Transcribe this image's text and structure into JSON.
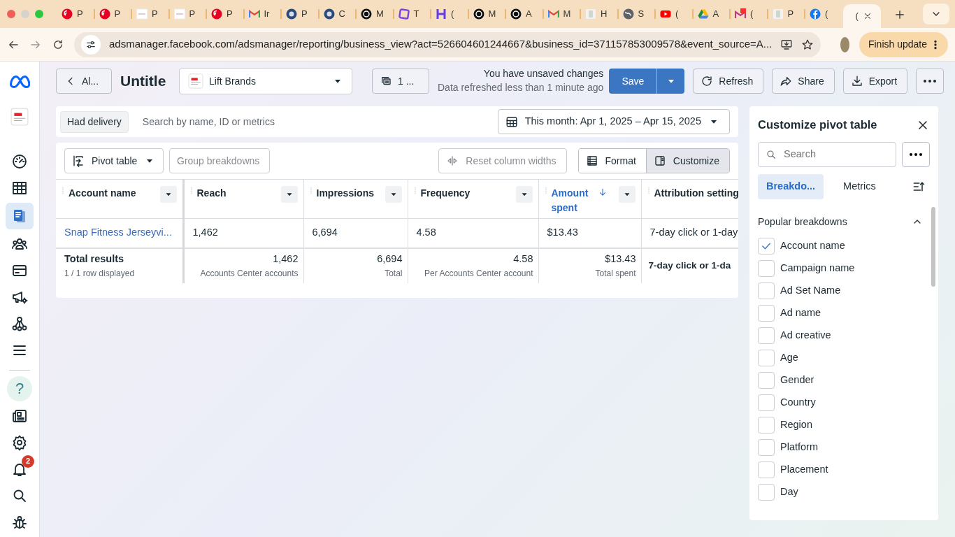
{
  "browser": {
    "tabs": [
      {
        "kind": "pin",
        "label": "P",
        "selected": false
      },
      {
        "kind": "pin",
        "label": "P",
        "selected": false
      },
      {
        "kind": "thumb",
        "label": "P",
        "selected": false
      },
      {
        "kind": "thumb",
        "label": "P",
        "selected": false
      },
      {
        "kind": "pin",
        "label": "P",
        "selected": false
      },
      {
        "kind": "mail",
        "label": "Ir",
        "selected": false
      },
      {
        "kind": "rider",
        "label": "P",
        "selected": false
      },
      {
        "kind": "rider",
        "label": "C",
        "selected": false
      },
      {
        "kind": "knot",
        "label": "M",
        "selected": false
      },
      {
        "kind": "square",
        "label": "T",
        "selected": false
      },
      {
        "kind": "hbar",
        "label": "(",
        "selected": false
      },
      {
        "kind": "knot",
        "label": "M",
        "selected": false
      },
      {
        "kind": "knot",
        "label": "A",
        "selected": false
      },
      {
        "kind": "mail",
        "label": "M",
        "selected": false
      },
      {
        "kind": "jar",
        "label": "H",
        "selected": false
      },
      {
        "kind": "globe",
        "label": "S",
        "selected": false
      },
      {
        "kind": "play",
        "label": "(",
        "selected": false
      },
      {
        "kind": "drive",
        "label": "A",
        "selected": false
      },
      {
        "kind": "mailbadge",
        "label": "(",
        "selected": false
      },
      {
        "kind": "jar",
        "label": "P",
        "selected": false
      },
      {
        "kind": "fb",
        "label": "(",
        "selected": false
      },
      {
        "kind": "blank",
        "label": "(",
        "selected": true
      }
    ],
    "url": "adsmanager.facebook.com/adsmanager/reporting/business_view?act=526604601244667&business_id=371157853009578&event_source=A...",
    "update_button": "Finish update"
  },
  "nav": {
    "items": [
      {
        "kind": "gauge",
        "selected": false
      },
      {
        "kind": "table",
        "selected": false
      },
      {
        "kind": "reports",
        "selected": true
      },
      {
        "kind": "people",
        "selected": false
      },
      {
        "kind": "card",
        "selected": false
      },
      {
        "kind": "megaphone",
        "selected": false
      },
      {
        "kind": "network",
        "selected": false
      },
      {
        "kind": "menu",
        "selected": false
      }
    ],
    "bottom_items": [
      {
        "kind": "help",
        "label": "?",
        "selected": false
      },
      {
        "kind": "news",
        "selected": false
      },
      {
        "kind": "gear",
        "selected": false
      },
      {
        "kind": "bell",
        "badge": "2",
        "selected": false
      },
      {
        "kind": "search",
        "selected": false
      },
      {
        "kind": "bug",
        "selected": false
      }
    ]
  },
  "header": {
    "back_button": "Al...",
    "title": "Untitle",
    "account": "Lift Brands",
    "views_button": "1 ...",
    "unsaved": "You have unsaved changes",
    "refreshed": "Data refreshed less than 1 minute ago",
    "buttons": [
      {
        "kind": "save",
        "label": "Save"
      },
      {
        "kind": "refresh",
        "label": "Refresh"
      },
      {
        "kind": "share",
        "label": "Share"
      },
      {
        "kind": "export",
        "label": "Export"
      },
      {
        "kind": "more"
      }
    ]
  },
  "filters": {
    "chip": "Had delivery",
    "search_placeholder": "Search by name, ID or metrics",
    "date": "This month: Apr 1, 2025 – Apr 15, 2025"
  },
  "toolbar": {
    "buttons": [
      {
        "kind": "pivot",
        "label": "Pivot table",
        "disabled": false
      },
      {
        "kind": "plain",
        "label": "Group breakdowns",
        "disabled": true
      },
      {
        "kind": "reset",
        "label": "Reset column widths",
        "disabled": true
      }
    ],
    "modes": [
      {
        "kind": "format",
        "label": "Format",
        "selected": false
      },
      {
        "kind": "customize",
        "label": "Customize",
        "selected": true
      }
    ]
  },
  "table": {
    "columns": [
      {
        "label": "Account name",
        "sorted": false
      },
      {
        "label": "Reach",
        "sorted": false
      },
      {
        "label": "Impressions",
        "sorted": false
      },
      {
        "label": "Frequency",
        "sorted": false
      },
      {
        "label": "Amount spent",
        "sorted": true
      },
      {
        "label": "Attribution setting",
        "sorted": false
      }
    ],
    "rows": [
      [
        "Snap Fitness Jerseyvi...",
        "1,462",
        "6,694",
        "4.58",
        "$13.43",
        "7-day click or 1-day"
      ]
    ],
    "totals": [
      {
        "value": "Total results",
        "note": "1 / 1 row displayed"
      },
      {
        "value": "1,462",
        "note": "Accounts Center accounts"
      },
      {
        "value": "6,694",
        "note": "Total"
      },
      {
        "value": "4.58",
        "note": "Per Accounts Center account"
      },
      {
        "value": "$13.43",
        "note": "Total spent"
      },
      {
        "value": "7-day click or 1-da"
      }
    ]
  },
  "panel": {
    "title": "Customize pivot table",
    "search_placeholder": "Search",
    "tabs": [
      {
        "label": "Breakdo...",
        "selected": true
      },
      {
        "label": "Metrics",
        "selected": false
      }
    ],
    "section": "Popular breakdowns",
    "items": [
      {
        "label": "Account name",
        "checked": true
      },
      {
        "label": "Campaign name",
        "checked": false
      },
      {
        "label": "Ad Set Name",
        "checked": false
      },
      {
        "label": "Ad name",
        "checked": false
      },
      {
        "label": "Ad creative",
        "checked": false
      },
      {
        "label": "Age",
        "checked": false
      },
      {
        "label": "Gender",
        "checked": false
      },
      {
        "label": "Country",
        "checked": false
      },
      {
        "label": "Region",
        "checked": false
      },
      {
        "label": "Platform",
        "checked": false
      },
      {
        "label": "Placement",
        "checked": false
      },
      {
        "label": "Day",
        "checked": false
      }
    ]
  }
}
